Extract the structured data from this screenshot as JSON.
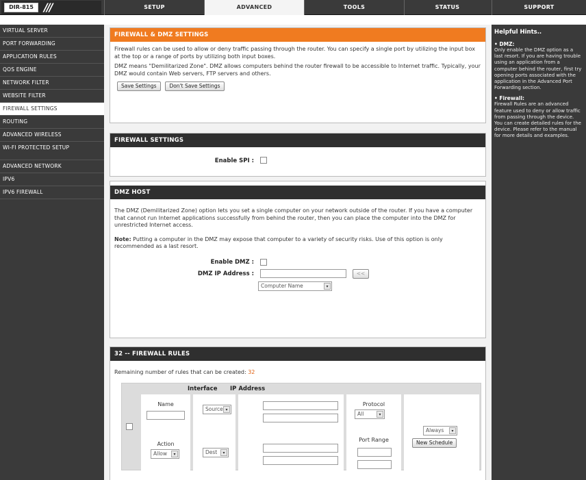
{
  "header": {
    "model": "DIR-815",
    "slashes": "///",
    "tabs": [
      "SETUP",
      "ADVANCED",
      "TOOLS",
      "STATUS",
      "SUPPORT"
    ]
  },
  "sidebar": {
    "items": [
      "VIRTUAL SERVER",
      "PORT FORWARDING",
      "APPLICATION RULES",
      "QOS ENGINE",
      "NETWORK FILTER",
      "WEBSITE FILTER",
      "FIREWALL SETTINGS",
      "ROUTING",
      "ADVANCED WIRELESS",
      "WI-FI PROTECTED SETUP",
      "ADVANCED NETWORK",
      "IPV6",
      "IPV6 FIREWALL"
    ],
    "active_index": 6
  },
  "intro": {
    "title": "FIREWALL & DMZ SETTINGS",
    "para1": "Firewall rules can be used to allow or deny traffic passing through the router. You can specify a single port by utilizing the input box at the top or a range of ports by utilizing both input boxes.",
    "para2": "DMZ means \"Demilitarized Zone\". DMZ allows computers behind the router firewall to be accessible to Internet traffic. Typically, your DMZ would contain Web servers, FTP servers and others.",
    "save_label": "Save Settings",
    "dont_save_label": "Don't Save Settings"
  },
  "firewall_settings": {
    "title": "FIREWALL SETTINGS",
    "spi_label": "Enable SPI :"
  },
  "dmz": {
    "title": "DMZ HOST",
    "para": "The DMZ (Demilitarized Zone) option lets you set a single computer on your network outside of the router. If you have a computer that cannot run Internet applications successfully from behind the router, then you can place the computer into the DMZ for unrestricted Internet access.",
    "note_bold": "Note:",
    "note_text": " Putting a computer in the DMZ may expose that computer to a variety of security risks. Use of this option is only recommended as a last resort.",
    "enable_label": "Enable DMZ :",
    "ip_label": "DMZ IP Address :",
    "copy_btn": "<<",
    "computer_name": "Computer Name"
  },
  "rules": {
    "title": "32 -- FIREWALL RULES",
    "remaining_text": "Remaining number of rules that can be created:",
    "remaining_count": "32",
    "col_interface": "Interface",
    "col_ip": "IP Address",
    "name_label": "Name",
    "action_label": "Action",
    "action_value": "Allow",
    "source_value": "Source",
    "dest_value": "Dest",
    "protocol_label": "Protocol",
    "protocol_value": "All",
    "port_range_label": "Port Range",
    "schedule_value": "Always",
    "new_schedule": "New Schedule"
  },
  "help": {
    "title": "Helpful Hints..",
    "dmz_head": "DMZ:",
    "dmz_text": "Only enable the DMZ option as a last resort. If you are having trouble using an application from a computer behind the router, first try opening ports associated with the application in the Advanced Port Forwarding section.",
    "fw_head": "Firewall:",
    "fw_text": "Firewall Rules are an advanced feature used to deny or allow traffic from passing through the device. You can create detailed rules for the device. Please refer to the manual for more details and examples."
  }
}
